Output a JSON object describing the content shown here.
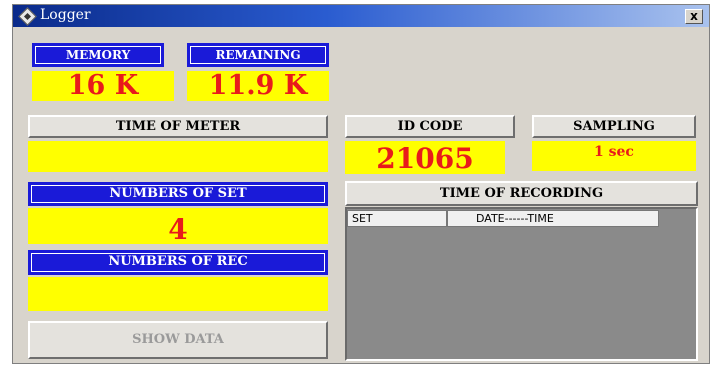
{
  "window": {
    "title": "Logger",
    "close_label": "x"
  },
  "memory": {
    "label": "MEMORY",
    "value": "16 K"
  },
  "remaining": {
    "label": "REMAINING",
    "value": "11.9 K"
  },
  "time_of_meter": {
    "label": "TIME OF METER",
    "value": ""
  },
  "id_code": {
    "label": "ID CODE",
    "value": "21065"
  },
  "sampling": {
    "label": "SAMPLING",
    "value": "1 sec"
  },
  "numbers_of_set": {
    "label": "NUMBERS OF SET",
    "value": "4"
  },
  "numbers_of_rec": {
    "label": "NUMBERS OF REC",
    "value": ""
  },
  "show_data": {
    "label": "SHOW DATA"
  },
  "recording": {
    "label": "TIME OF RECORDING",
    "columns": [
      "SET",
      "DATE------TIME"
    ]
  },
  "colors": {
    "label_blue": "#1a1ad8",
    "value_yellow": "#ffff00",
    "value_red": "#e81b1b",
    "panel_gray": "#d8d4cc"
  }
}
